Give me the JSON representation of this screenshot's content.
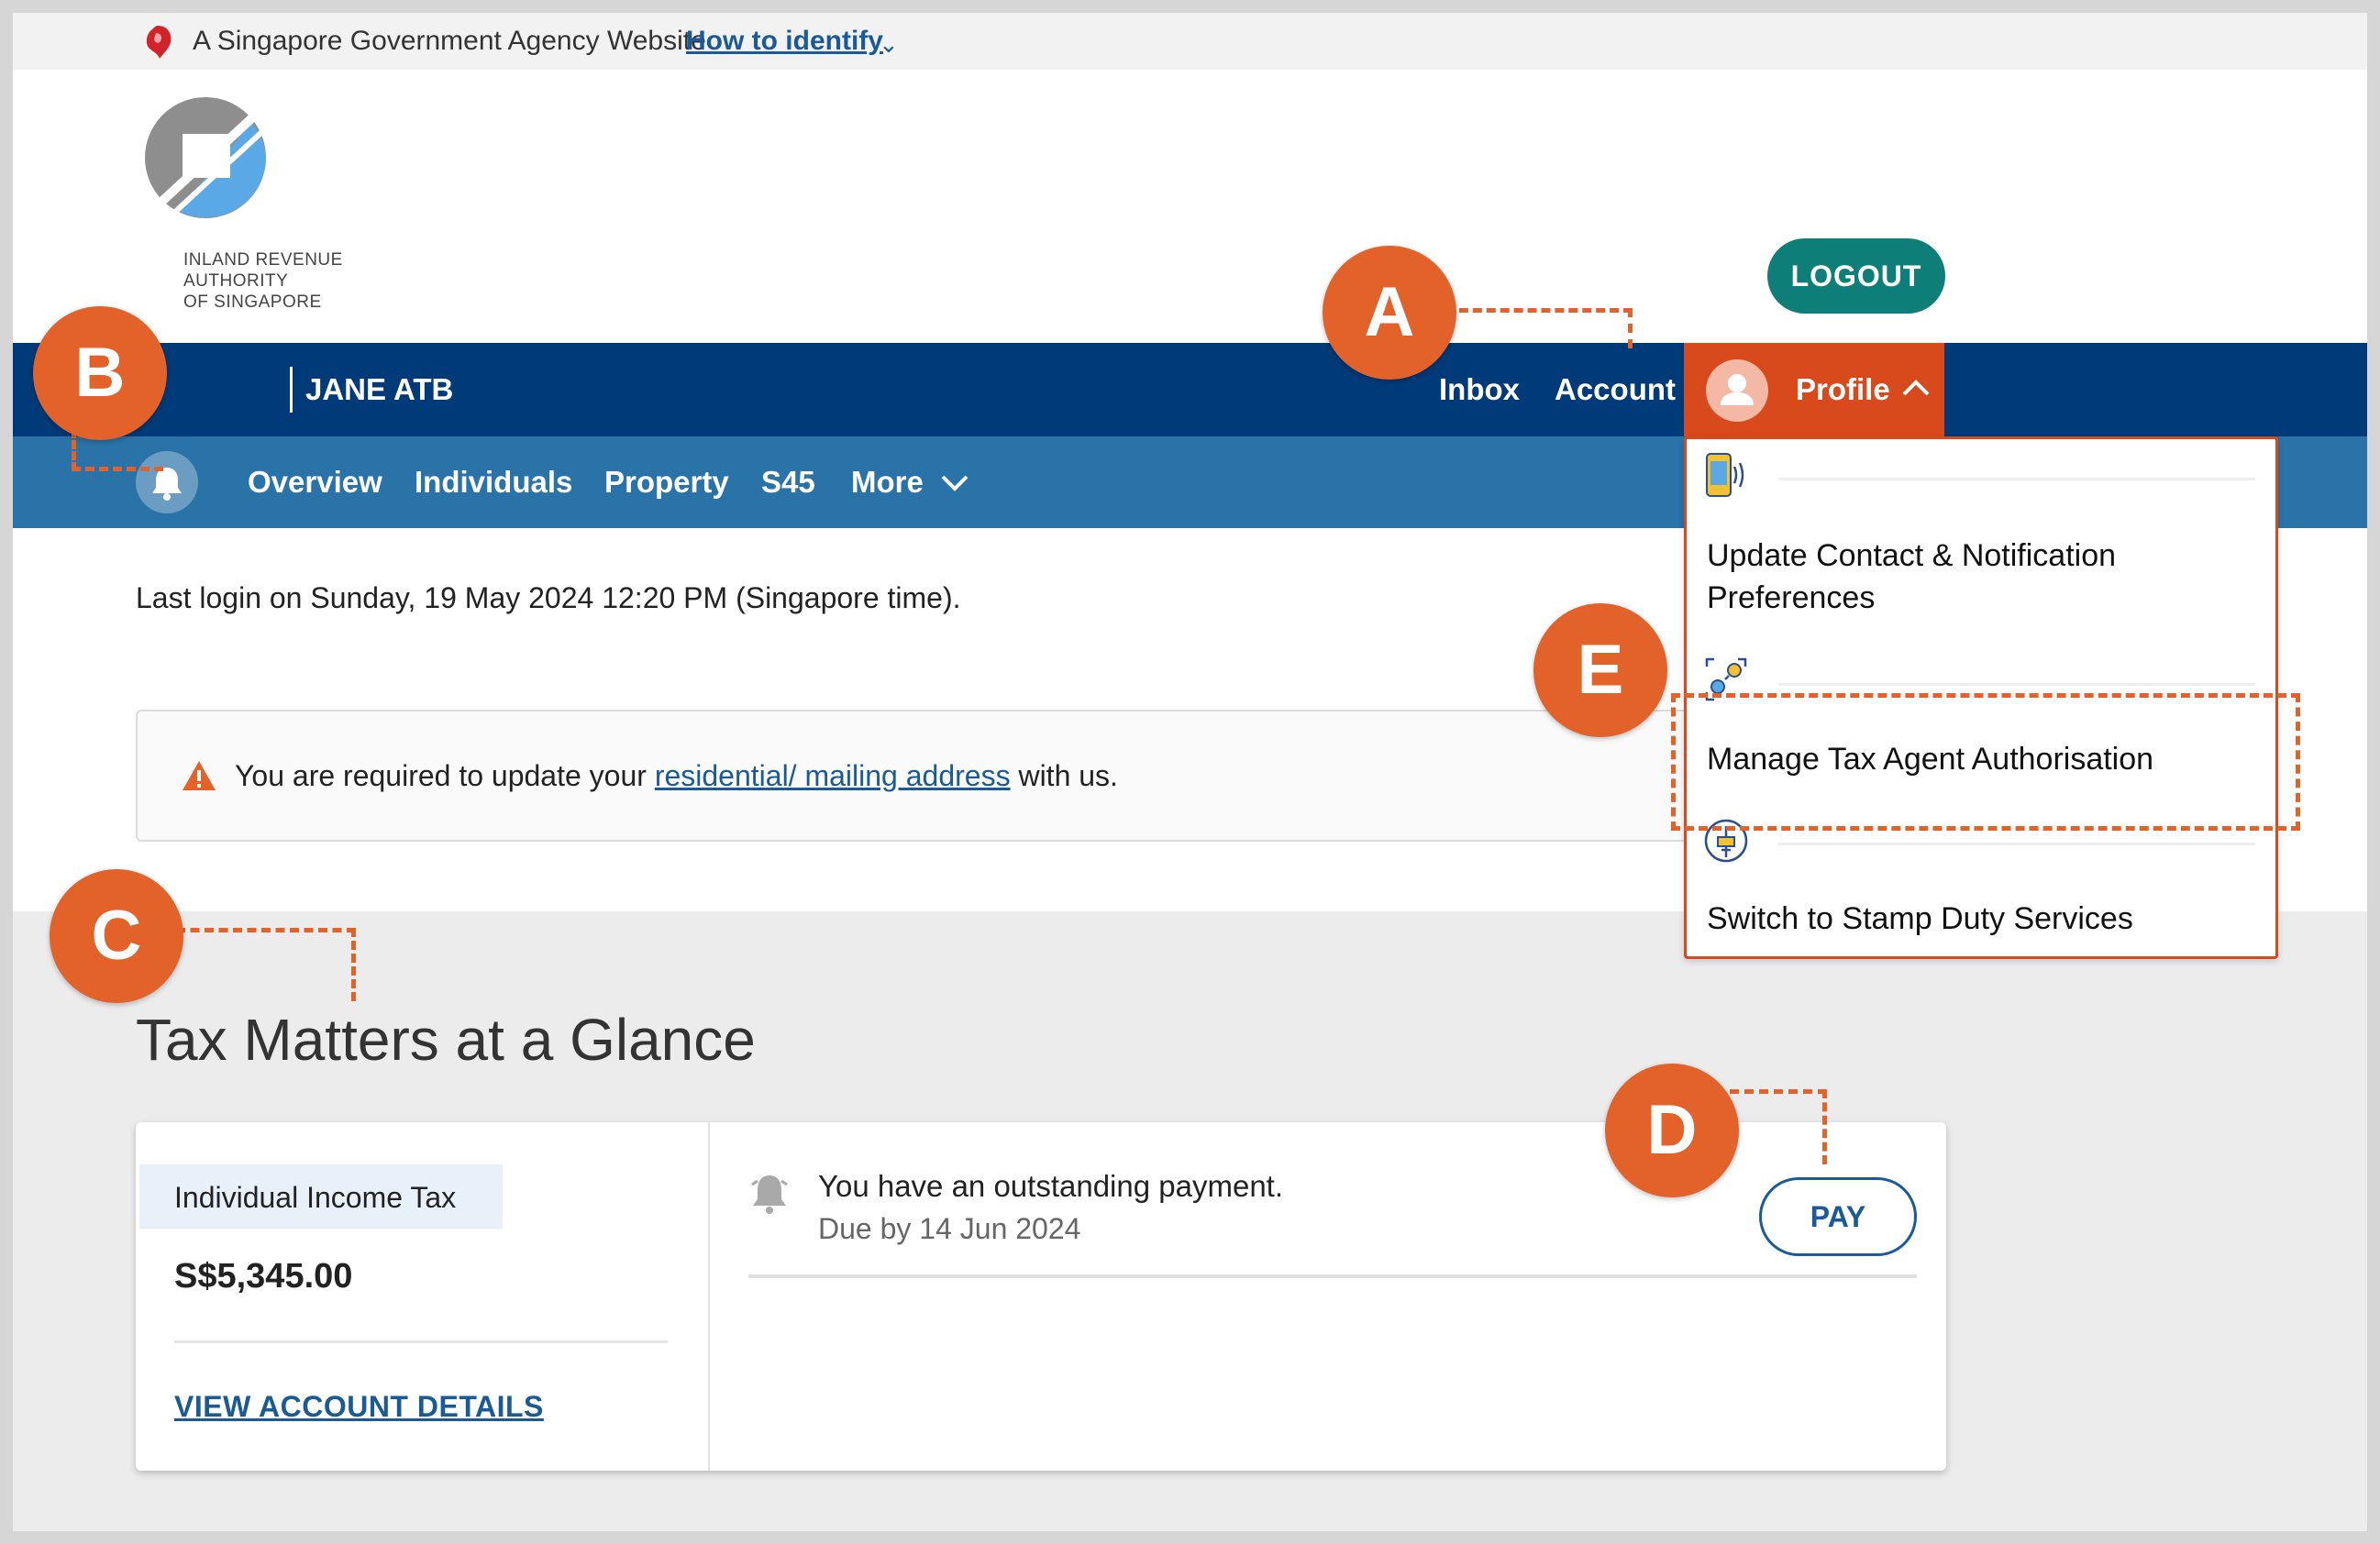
{
  "gov_banner": {
    "text": "A Singapore Government Agency Website",
    "identify_link": "How to identify"
  },
  "logo": {
    "line1": "INLAND REVENUE",
    "line2": "AUTHORITY",
    "line3": "OF SINGAPORE"
  },
  "header": {
    "logout_label": "LOGOUT"
  },
  "top_nav": {
    "user_name": "JANE ATB",
    "inbox": "Inbox",
    "account": "Account",
    "profile": "Profile"
  },
  "sub_nav": {
    "items": [
      "Overview",
      "Individuals",
      "Property",
      "S45",
      "More"
    ]
  },
  "main": {
    "last_login": "Last login on Sunday, 19 May 2024 12:20 PM (Singapore time).",
    "alert_prefix": "You are required to update your ",
    "alert_link": "residential/ mailing address",
    "alert_suffix": " with us."
  },
  "glance": {
    "title": "Tax Matters at a Glance",
    "tax_type": "Individual Income Tax",
    "amount": "S$5,345.00",
    "view_link": "VIEW ACCOUNT DETAILS",
    "payment_title": "You have an outstanding payment.",
    "payment_due": "Due by 14 Jun 2024",
    "pay_label": "PAY"
  },
  "profile_menu": {
    "items": [
      {
        "label_line1": "Update Contact & Notification",
        "label_line2": "Preferences",
        "icon": "phone-notification-icon"
      },
      {
        "label_line1": "Manage Tax Agent Authorisation",
        "icon": "tax-agent-icon"
      },
      {
        "label_line1": "Switch to Stamp Duty Services",
        "icon": "stamp-duty-icon"
      }
    ]
  },
  "annotations": {
    "a": "A",
    "b": "B",
    "c": "C",
    "d": "D",
    "e": "E"
  },
  "colors": {
    "nav_dark": "#003a78",
    "nav_light": "#2a73a8",
    "profile_orange": "#d8491b",
    "annotation": "#e2622a",
    "logout_teal": "#0d7f78",
    "link_blue": "#1a5a96"
  }
}
